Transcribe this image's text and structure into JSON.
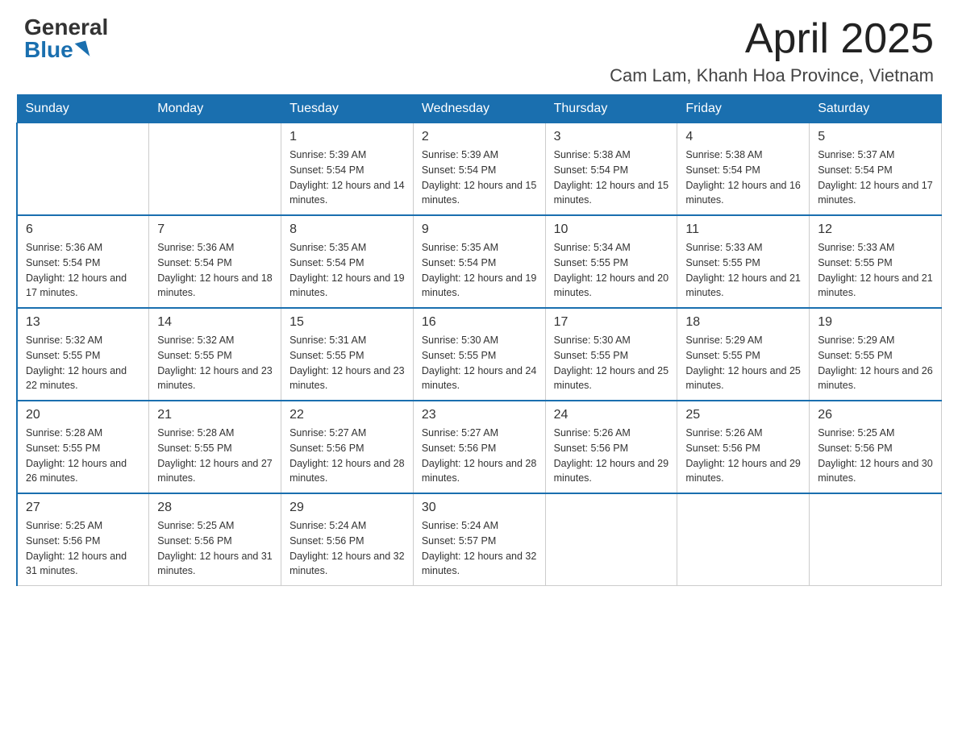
{
  "header": {
    "logo_general": "General",
    "logo_blue": "Blue",
    "month_title": "April 2025",
    "location": "Cam Lam, Khanh Hoa Province, Vietnam"
  },
  "weekdays": [
    "Sunday",
    "Monday",
    "Tuesday",
    "Wednesday",
    "Thursday",
    "Friday",
    "Saturday"
  ],
  "weeks": [
    [
      {
        "day": "",
        "sunrise": "",
        "sunset": "",
        "daylight": ""
      },
      {
        "day": "",
        "sunrise": "",
        "sunset": "",
        "daylight": ""
      },
      {
        "day": "1",
        "sunrise": "Sunrise: 5:39 AM",
        "sunset": "Sunset: 5:54 PM",
        "daylight": "Daylight: 12 hours and 14 minutes."
      },
      {
        "day": "2",
        "sunrise": "Sunrise: 5:39 AM",
        "sunset": "Sunset: 5:54 PM",
        "daylight": "Daylight: 12 hours and 15 minutes."
      },
      {
        "day": "3",
        "sunrise": "Sunrise: 5:38 AM",
        "sunset": "Sunset: 5:54 PM",
        "daylight": "Daylight: 12 hours and 15 minutes."
      },
      {
        "day": "4",
        "sunrise": "Sunrise: 5:38 AM",
        "sunset": "Sunset: 5:54 PM",
        "daylight": "Daylight: 12 hours and 16 minutes."
      },
      {
        "day": "5",
        "sunrise": "Sunrise: 5:37 AM",
        "sunset": "Sunset: 5:54 PM",
        "daylight": "Daylight: 12 hours and 17 minutes."
      }
    ],
    [
      {
        "day": "6",
        "sunrise": "Sunrise: 5:36 AM",
        "sunset": "Sunset: 5:54 PM",
        "daylight": "Daylight: 12 hours and 17 minutes."
      },
      {
        "day": "7",
        "sunrise": "Sunrise: 5:36 AM",
        "sunset": "Sunset: 5:54 PM",
        "daylight": "Daylight: 12 hours and 18 minutes."
      },
      {
        "day": "8",
        "sunrise": "Sunrise: 5:35 AM",
        "sunset": "Sunset: 5:54 PM",
        "daylight": "Daylight: 12 hours and 19 minutes."
      },
      {
        "day": "9",
        "sunrise": "Sunrise: 5:35 AM",
        "sunset": "Sunset: 5:54 PM",
        "daylight": "Daylight: 12 hours and 19 minutes."
      },
      {
        "day": "10",
        "sunrise": "Sunrise: 5:34 AM",
        "sunset": "Sunset: 5:55 PM",
        "daylight": "Daylight: 12 hours and 20 minutes."
      },
      {
        "day": "11",
        "sunrise": "Sunrise: 5:33 AM",
        "sunset": "Sunset: 5:55 PM",
        "daylight": "Daylight: 12 hours and 21 minutes."
      },
      {
        "day": "12",
        "sunrise": "Sunrise: 5:33 AM",
        "sunset": "Sunset: 5:55 PM",
        "daylight": "Daylight: 12 hours and 21 minutes."
      }
    ],
    [
      {
        "day": "13",
        "sunrise": "Sunrise: 5:32 AM",
        "sunset": "Sunset: 5:55 PM",
        "daylight": "Daylight: 12 hours and 22 minutes."
      },
      {
        "day": "14",
        "sunrise": "Sunrise: 5:32 AM",
        "sunset": "Sunset: 5:55 PM",
        "daylight": "Daylight: 12 hours and 23 minutes."
      },
      {
        "day": "15",
        "sunrise": "Sunrise: 5:31 AM",
        "sunset": "Sunset: 5:55 PM",
        "daylight": "Daylight: 12 hours and 23 minutes."
      },
      {
        "day": "16",
        "sunrise": "Sunrise: 5:30 AM",
        "sunset": "Sunset: 5:55 PM",
        "daylight": "Daylight: 12 hours and 24 minutes."
      },
      {
        "day": "17",
        "sunrise": "Sunrise: 5:30 AM",
        "sunset": "Sunset: 5:55 PM",
        "daylight": "Daylight: 12 hours and 25 minutes."
      },
      {
        "day": "18",
        "sunrise": "Sunrise: 5:29 AM",
        "sunset": "Sunset: 5:55 PM",
        "daylight": "Daylight: 12 hours and 25 minutes."
      },
      {
        "day": "19",
        "sunrise": "Sunrise: 5:29 AM",
        "sunset": "Sunset: 5:55 PM",
        "daylight": "Daylight: 12 hours and 26 minutes."
      }
    ],
    [
      {
        "day": "20",
        "sunrise": "Sunrise: 5:28 AM",
        "sunset": "Sunset: 5:55 PM",
        "daylight": "Daylight: 12 hours and 26 minutes."
      },
      {
        "day": "21",
        "sunrise": "Sunrise: 5:28 AM",
        "sunset": "Sunset: 5:55 PM",
        "daylight": "Daylight: 12 hours and 27 minutes."
      },
      {
        "day": "22",
        "sunrise": "Sunrise: 5:27 AM",
        "sunset": "Sunset: 5:56 PM",
        "daylight": "Daylight: 12 hours and 28 minutes."
      },
      {
        "day": "23",
        "sunrise": "Sunrise: 5:27 AM",
        "sunset": "Sunset: 5:56 PM",
        "daylight": "Daylight: 12 hours and 28 minutes."
      },
      {
        "day": "24",
        "sunrise": "Sunrise: 5:26 AM",
        "sunset": "Sunset: 5:56 PM",
        "daylight": "Daylight: 12 hours and 29 minutes."
      },
      {
        "day": "25",
        "sunrise": "Sunrise: 5:26 AM",
        "sunset": "Sunset: 5:56 PM",
        "daylight": "Daylight: 12 hours and 29 minutes."
      },
      {
        "day": "26",
        "sunrise": "Sunrise: 5:25 AM",
        "sunset": "Sunset: 5:56 PM",
        "daylight": "Daylight: 12 hours and 30 minutes."
      }
    ],
    [
      {
        "day": "27",
        "sunrise": "Sunrise: 5:25 AM",
        "sunset": "Sunset: 5:56 PM",
        "daylight": "Daylight: 12 hours and 31 minutes."
      },
      {
        "day": "28",
        "sunrise": "Sunrise: 5:25 AM",
        "sunset": "Sunset: 5:56 PM",
        "daylight": "Daylight: 12 hours and 31 minutes."
      },
      {
        "day": "29",
        "sunrise": "Sunrise: 5:24 AM",
        "sunset": "Sunset: 5:56 PM",
        "daylight": "Daylight: 12 hours and 32 minutes."
      },
      {
        "day": "30",
        "sunrise": "Sunrise: 5:24 AM",
        "sunset": "Sunset: 5:57 PM",
        "daylight": "Daylight: 12 hours and 32 minutes."
      },
      {
        "day": "",
        "sunrise": "",
        "sunset": "",
        "daylight": ""
      },
      {
        "day": "",
        "sunrise": "",
        "sunset": "",
        "daylight": ""
      },
      {
        "day": "",
        "sunrise": "",
        "sunset": "",
        "daylight": ""
      }
    ]
  ]
}
